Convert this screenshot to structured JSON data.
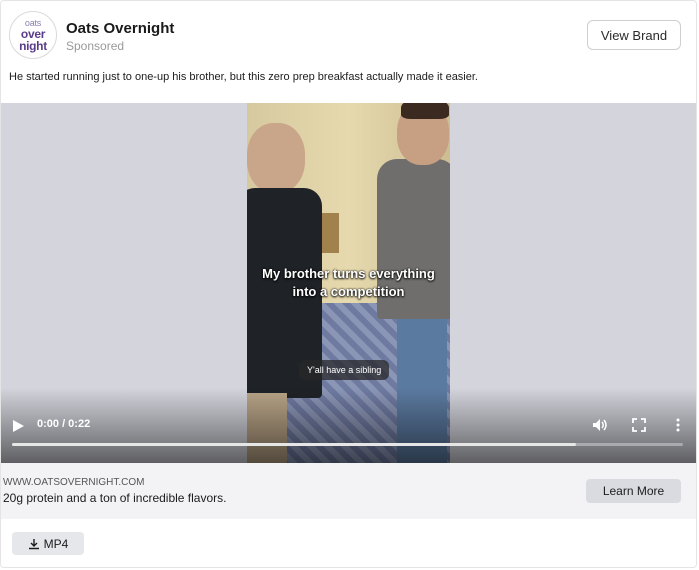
{
  "ad": {
    "logo_lines": [
      "oats",
      "over",
      "night"
    ],
    "brand_name": "Oats Overnight",
    "sponsored_label": "Sponsored",
    "view_brand_label": "View Brand",
    "caption": "He started running just to one-up his brother, but this zero prep breakfast actually made it easier."
  },
  "video": {
    "subtitle_line1": "My brother turns everything",
    "subtitle_line2": "into a competition",
    "pill_text": "Y'all have a sibling",
    "time_display": "0:00 / 0:22",
    "progress": 0.84,
    "icons": [
      "play-icon",
      "volume-icon",
      "fullscreen-icon",
      "more-options-icon"
    ]
  },
  "footer": {
    "site": "WWW.OATSOVERNIGHT.COM",
    "description": "20g protein and a ton of incredible flavors.",
    "cta_label": "Learn More"
  },
  "download": {
    "label": "MP4",
    "icon": "download-icon"
  }
}
